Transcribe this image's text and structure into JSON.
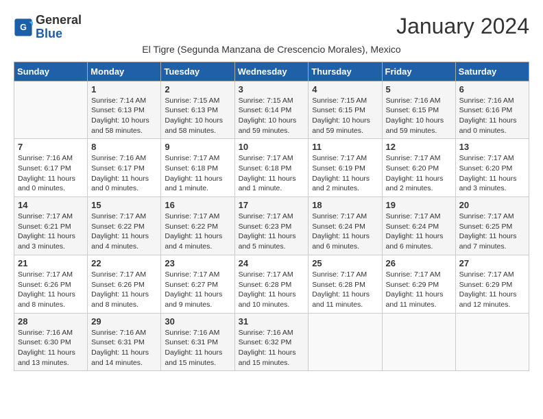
{
  "header": {
    "title": "January 2024",
    "subtitle": "El Tigre (Segunda Manzana de Crescencio Morales), Mexico",
    "logo_general": "General",
    "logo_blue": "Blue"
  },
  "columns": [
    "Sunday",
    "Monday",
    "Tuesday",
    "Wednesday",
    "Thursday",
    "Friday",
    "Saturday"
  ],
  "weeks": [
    [
      {
        "day": "",
        "sunrise": "",
        "sunset": "",
        "daylight": ""
      },
      {
        "day": "1",
        "sunrise": "Sunrise: 7:14 AM",
        "sunset": "Sunset: 6:13 PM",
        "daylight": "Daylight: 10 hours and 58 minutes."
      },
      {
        "day": "2",
        "sunrise": "Sunrise: 7:15 AM",
        "sunset": "Sunset: 6:13 PM",
        "daylight": "Daylight: 10 hours and 58 minutes."
      },
      {
        "day": "3",
        "sunrise": "Sunrise: 7:15 AM",
        "sunset": "Sunset: 6:14 PM",
        "daylight": "Daylight: 10 hours and 59 minutes."
      },
      {
        "day": "4",
        "sunrise": "Sunrise: 7:15 AM",
        "sunset": "Sunset: 6:15 PM",
        "daylight": "Daylight: 10 hours and 59 minutes."
      },
      {
        "day": "5",
        "sunrise": "Sunrise: 7:16 AM",
        "sunset": "Sunset: 6:15 PM",
        "daylight": "Daylight: 10 hours and 59 minutes."
      },
      {
        "day": "6",
        "sunrise": "Sunrise: 7:16 AM",
        "sunset": "Sunset: 6:16 PM",
        "daylight": "Daylight: 11 hours and 0 minutes."
      }
    ],
    [
      {
        "day": "7",
        "sunrise": "Sunrise: 7:16 AM",
        "sunset": "Sunset: 6:17 PM",
        "daylight": "Daylight: 11 hours and 0 minutes."
      },
      {
        "day": "8",
        "sunrise": "Sunrise: 7:16 AM",
        "sunset": "Sunset: 6:17 PM",
        "daylight": "Daylight: 11 hours and 0 minutes."
      },
      {
        "day": "9",
        "sunrise": "Sunrise: 7:17 AM",
        "sunset": "Sunset: 6:18 PM",
        "daylight": "Daylight: 11 hours and 1 minute."
      },
      {
        "day": "10",
        "sunrise": "Sunrise: 7:17 AM",
        "sunset": "Sunset: 6:18 PM",
        "daylight": "Daylight: 11 hours and 1 minute."
      },
      {
        "day": "11",
        "sunrise": "Sunrise: 7:17 AM",
        "sunset": "Sunset: 6:19 PM",
        "daylight": "Daylight: 11 hours and 2 minutes."
      },
      {
        "day": "12",
        "sunrise": "Sunrise: 7:17 AM",
        "sunset": "Sunset: 6:20 PM",
        "daylight": "Daylight: 11 hours and 2 minutes."
      },
      {
        "day": "13",
        "sunrise": "Sunrise: 7:17 AM",
        "sunset": "Sunset: 6:20 PM",
        "daylight": "Daylight: 11 hours and 3 minutes."
      }
    ],
    [
      {
        "day": "14",
        "sunrise": "Sunrise: 7:17 AM",
        "sunset": "Sunset: 6:21 PM",
        "daylight": "Daylight: 11 hours and 3 minutes."
      },
      {
        "day": "15",
        "sunrise": "Sunrise: 7:17 AM",
        "sunset": "Sunset: 6:22 PM",
        "daylight": "Daylight: 11 hours and 4 minutes."
      },
      {
        "day": "16",
        "sunrise": "Sunrise: 7:17 AM",
        "sunset": "Sunset: 6:22 PM",
        "daylight": "Daylight: 11 hours and 4 minutes."
      },
      {
        "day": "17",
        "sunrise": "Sunrise: 7:17 AM",
        "sunset": "Sunset: 6:23 PM",
        "daylight": "Daylight: 11 hours and 5 minutes."
      },
      {
        "day": "18",
        "sunrise": "Sunrise: 7:17 AM",
        "sunset": "Sunset: 6:24 PM",
        "daylight": "Daylight: 11 hours and 6 minutes."
      },
      {
        "day": "19",
        "sunrise": "Sunrise: 7:17 AM",
        "sunset": "Sunset: 6:24 PM",
        "daylight": "Daylight: 11 hours and 6 minutes."
      },
      {
        "day": "20",
        "sunrise": "Sunrise: 7:17 AM",
        "sunset": "Sunset: 6:25 PM",
        "daylight": "Daylight: 11 hours and 7 minutes."
      }
    ],
    [
      {
        "day": "21",
        "sunrise": "Sunrise: 7:17 AM",
        "sunset": "Sunset: 6:26 PM",
        "daylight": "Daylight: 11 hours and 8 minutes."
      },
      {
        "day": "22",
        "sunrise": "Sunrise: 7:17 AM",
        "sunset": "Sunset: 6:26 PM",
        "daylight": "Daylight: 11 hours and 8 minutes."
      },
      {
        "day": "23",
        "sunrise": "Sunrise: 7:17 AM",
        "sunset": "Sunset: 6:27 PM",
        "daylight": "Daylight: 11 hours and 9 minutes."
      },
      {
        "day": "24",
        "sunrise": "Sunrise: 7:17 AM",
        "sunset": "Sunset: 6:28 PM",
        "daylight": "Daylight: 11 hours and 10 minutes."
      },
      {
        "day": "25",
        "sunrise": "Sunrise: 7:17 AM",
        "sunset": "Sunset: 6:28 PM",
        "daylight": "Daylight: 11 hours and 11 minutes."
      },
      {
        "day": "26",
        "sunrise": "Sunrise: 7:17 AM",
        "sunset": "Sunset: 6:29 PM",
        "daylight": "Daylight: 11 hours and 11 minutes."
      },
      {
        "day": "27",
        "sunrise": "Sunrise: 7:17 AM",
        "sunset": "Sunset: 6:29 PM",
        "daylight": "Daylight: 11 hours and 12 minutes."
      }
    ],
    [
      {
        "day": "28",
        "sunrise": "Sunrise: 7:16 AM",
        "sunset": "Sunset: 6:30 PM",
        "daylight": "Daylight: 11 hours and 13 minutes."
      },
      {
        "day": "29",
        "sunrise": "Sunrise: 7:16 AM",
        "sunset": "Sunset: 6:31 PM",
        "daylight": "Daylight: 11 hours and 14 minutes."
      },
      {
        "day": "30",
        "sunrise": "Sunrise: 7:16 AM",
        "sunset": "Sunset: 6:31 PM",
        "daylight": "Daylight: 11 hours and 15 minutes."
      },
      {
        "day": "31",
        "sunrise": "Sunrise: 7:16 AM",
        "sunset": "Sunset: 6:32 PM",
        "daylight": "Daylight: 11 hours and 15 minutes."
      },
      {
        "day": "",
        "sunrise": "",
        "sunset": "",
        "daylight": ""
      },
      {
        "day": "",
        "sunrise": "",
        "sunset": "",
        "daylight": ""
      },
      {
        "day": "",
        "sunrise": "",
        "sunset": "",
        "daylight": ""
      }
    ]
  ]
}
